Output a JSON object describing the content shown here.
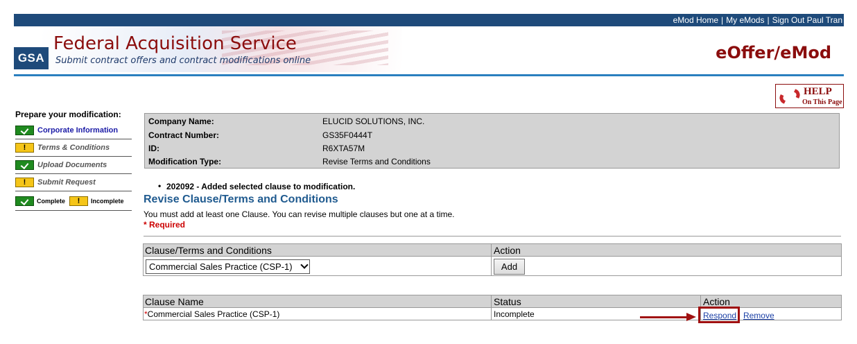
{
  "topnav": {
    "home": "eMod Home",
    "mine": "My eMods",
    "signout": "Sign Out Paul Tran",
    "sep": "|"
  },
  "banner": {
    "logo": "GSA",
    "title": "Federal Acquisition Service",
    "subtitle": "Submit contract offers and contract modifications online",
    "app_title": "eOffer/eMod"
  },
  "help": {
    "label": "HELP",
    "sub": "On This Page",
    "icon": "lifebuoy-icon"
  },
  "sidebar": {
    "title": "Prepare your modification:",
    "items": [
      {
        "label": "Corporate Information",
        "status": "complete"
      },
      {
        "label": "Terms & Conditions",
        "status": "incomplete"
      },
      {
        "label": "Upload Documents",
        "status": "complete"
      },
      {
        "label": "Submit Request",
        "status": "incomplete"
      }
    ],
    "legend": {
      "complete": "Complete",
      "incomplete": "Incomplete"
    }
  },
  "info": {
    "company_label": "Company Name:",
    "company_value": "ELUCID SOLUTIONS, INC.",
    "contract_label": "Contract Number:",
    "contract_value": "GS35F0444T",
    "id_label": "ID:",
    "id_value": "R6XTA57M",
    "modtype_label": "Modification Type:",
    "modtype_value": "Revise Terms and Conditions"
  },
  "message": "202092 - Added selected clause to modification.",
  "section": {
    "title": "Revise Clause/Terms and Conditions",
    "instructions": "You must add at least one Clause. You can revise multiple clauses but one at a time.",
    "required": "* Required"
  },
  "add_table": {
    "col1": "Clause/Terms and Conditions",
    "col2": "Action",
    "selected": "Commercial Sales Practice (CSP-1)",
    "add_label": "Add"
  },
  "clause_table": {
    "col1": "Clause Name",
    "col2": "Status",
    "col3": "Action",
    "rows": [
      {
        "required_mark": "*",
        "name": "Commercial Sales Practice (CSP-1)",
        "status": "Incomplete",
        "respond": "Respond",
        "remove": "Remove"
      }
    ]
  }
}
